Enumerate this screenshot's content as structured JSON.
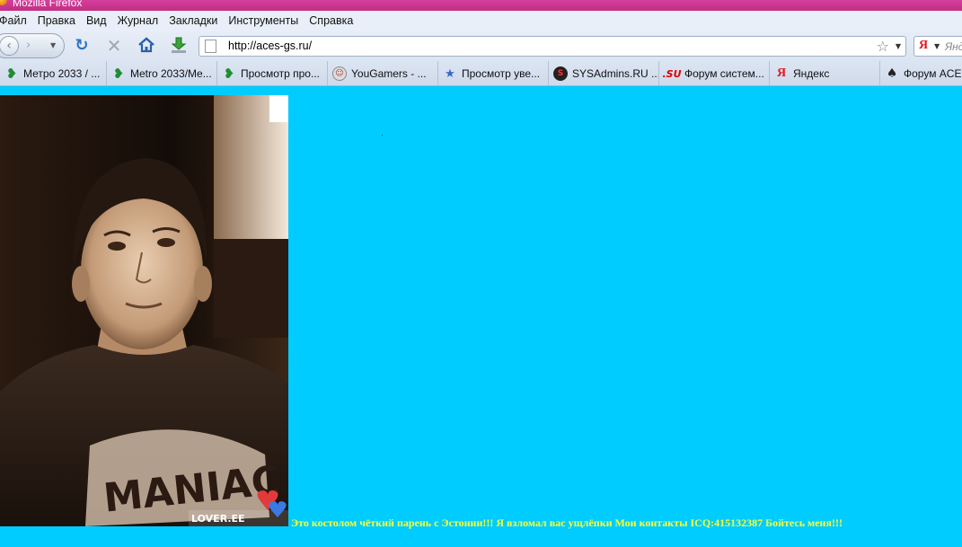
{
  "window": {
    "title": "Mozilla Firefox"
  },
  "menu": [
    "Файл",
    "Правка",
    "Вид",
    "Журнал",
    "Закладки",
    "Инструменты",
    "Справка"
  ],
  "navigation": {
    "url": "http://aces-gs.ru/",
    "search_placeholder": "Янд"
  },
  "bookmarks": [
    {
      "label": "Метро 2033 / ...",
      "icon": "ie-icon"
    },
    {
      "label": "Metro 2033/Me...",
      "icon": "ie-icon"
    },
    {
      "label": "Просмотр про...",
      "icon": "ie-icon"
    },
    {
      "label": "YouGamers - ...",
      "icon": "yougamers-icon"
    },
    {
      "label": "Просмотр уве...",
      "icon": "pin-icon"
    },
    {
      "label": "SYSAdmins.RU ...",
      "icon": "sysadmins-icon"
    },
    {
      "label": "Форум систем...",
      "icon": "su-icon",
      "badge": ".SU"
    },
    {
      "label": "Яндекс",
      "icon": "yandex-icon",
      "badge": "Я"
    },
    {
      "label": "Форум ACE",
      "icon": "ace-icon"
    }
  ],
  "page": {
    "image_logo": "LOVER.EE",
    "shirt_text": "MANIAC",
    "message": "Это костолом чёткий парень с Эстонии!!! Я взломал вас ущлёпки Мои контакты ICQ:415132387 Бойтесь меня!!!",
    "background_color": "#00ccff",
    "message_color": "#ffff33"
  }
}
